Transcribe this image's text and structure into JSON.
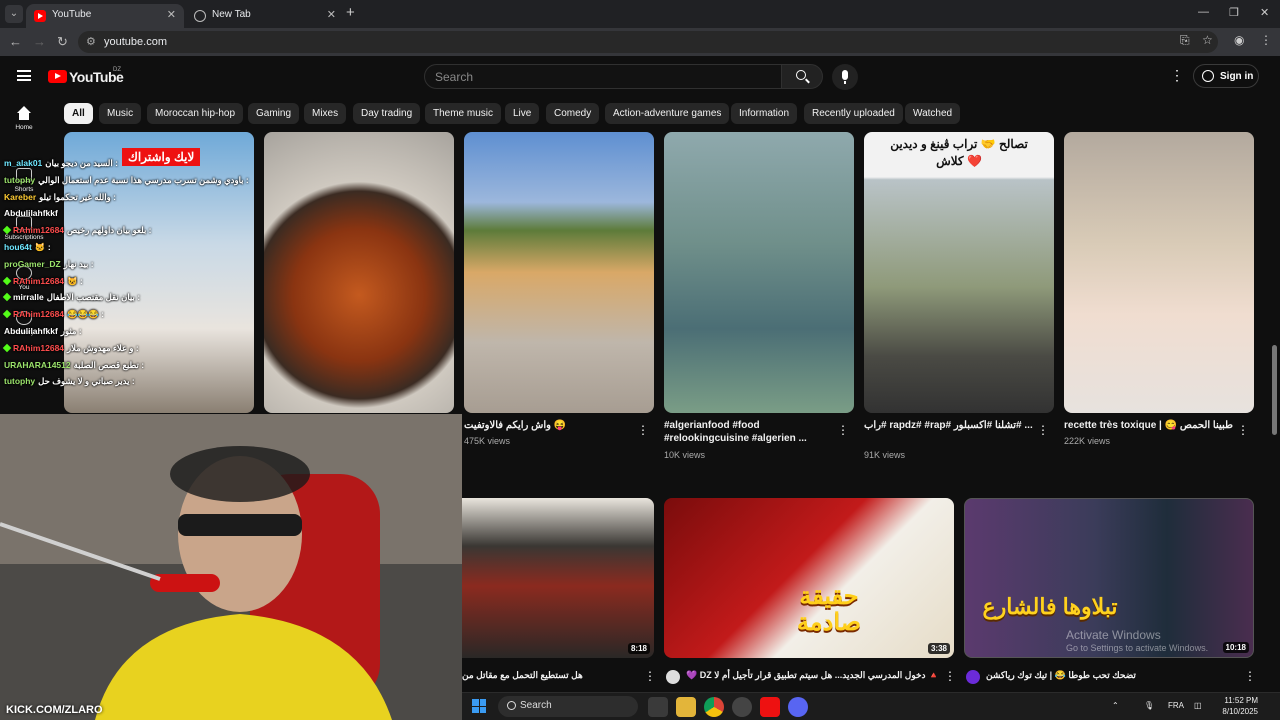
{
  "browser": {
    "tabs": [
      {
        "title": "YouTube",
        "close": "✕"
      },
      {
        "title": "New Tab",
        "close": "✕"
      }
    ],
    "new_tab": "+",
    "url": "youtube.com",
    "window": {
      "minimize": "—",
      "maximize": "❐",
      "close": "✕"
    }
  },
  "youtube": {
    "logo_text": "YouTube",
    "country": "DZ",
    "search_placeholder": "Search",
    "signin_label": "Sign in",
    "sidebar": [
      {
        "label": "Home",
        "icon": "home-icon"
      },
      {
        "label": "Shorts",
        "icon": "shorts-icon"
      },
      {
        "label": "Subscriptions",
        "icon": "subscriptions-icon"
      },
      {
        "label": "You",
        "icon": "you-icon"
      },
      {
        "label": "History",
        "icon": "history-icon"
      }
    ],
    "chips": [
      "All",
      "Music",
      "Moroccan hip-hop",
      "Gaming",
      "Mixes",
      "Day trading",
      "Theme music",
      "Live",
      "Comedy",
      "Action-adventure games",
      "Information",
      "Recently uploaded",
      "Watched"
    ],
    "shorts": [
      {
        "title": "",
        "views": "",
        "overlay": "لايك واشتراك"
      },
      {
        "title": "",
        "views": ""
      },
      {
        "title": "واش رايكم فالاوتفيت 😝",
        "views": "475K views"
      },
      {
        "title": "#algerianfood #food #relookingcuisine #algerien ...",
        "views": "10K views"
      },
      {
        "title": "راب# rapdz# #rap# تشلنا #اكسبلور# ...",
        "views": "91K views",
        "overlay": "تصالح 🤝 تراب ڤينغ و ديدين كلاش ❤️"
      },
      {
        "title": "recette très toxique | 😋 طبينا الحمص",
        "views": "222K views"
      }
    ],
    "videos": [
      {
        "title": "هل تستطيع التحمل مع مقاتل من",
        "duration": "8:18",
        "overlay": ""
      },
      {
        "title": "💜 DZ دخول المدرسي الجديد... هل سيتم تطبيق قرار تأجيل أم لا 🔺",
        "duration": "3:38",
        "overlay": "حقيقة صادمة"
      },
      {
        "title": "تضحك تحب طوطا 😂 | تيك توك رياكشن",
        "duration": "10:18",
        "overlay": "تبلاوها فالشارع"
      }
    ]
  },
  "stream": {
    "chat": [
      {
        "user": "m_alak01",
        "msg": "السيد من ديجو بيان :",
        "color": "#6ee7ff"
      },
      {
        "user": "tutophy",
        "msg": "باودي وشمن تسرب مدرسي هذا نسبة عدم استعمال الوالي :",
        "color": "#9be36b"
      },
      {
        "user": "Kareber",
        "msg": "والله غير تحكموا تيلو :",
        "color": "#ffcc33"
      },
      {
        "user": "Abdulilahfkkf",
        "msg": "",
        "color": "#ffffff"
      },
      {
        "user": "RAhim12684",
        "msg": "بلعو بيان داولهم رخيص :",
        "color": "#ff4d4d",
        "badge": true
      },
      {
        "user": "hou64t",
        "msg": "🐱 :",
        "color": "#6ee7ff"
      },
      {
        "user": "proGamer_DZ",
        "msg": "بيد نهار :",
        "color": "#9be36b"
      },
      {
        "user": "RAhim12684",
        "msg": "😺 :",
        "color": "#ff4d4d",
        "badge": true
      },
      {
        "user": "mirralle",
        "msg": "بيان نقل مقتصب الاطفال :",
        "color": "#ffffff",
        "badge": true
      },
      {
        "user": "RAhim12684",
        "msg": "😂😂😂 :",
        "color": "#ff4d4d",
        "badge": true
      },
      {
        "user": "Abdulilahfkkf",
        "msg": "مثور :",
        "color": "#ffffff"
      },
      {
        "user": "RAhim12684",
        "msg": "و علاء مهدوش ملار :",
        "color": "#ff4d4d",
        "badge": true
      },
      {
        "user": "URAHARA14512",
        "msg": "تطبع قصص الصلبة :",
        "color": "#9be36b"
      },
      {
        "user": "tutophy",
        "msg": "يدير صباتي و لا يشوف حل :",
        "color": "#9be36b"
      }
    ],
    "cam_handle": "KICK.COM/ZLARO"
  },
  "watermark": {
    "line1": "Activate Windows",
    "line2": "Go to Settings to activate Windows."
  },
  "taskbar": {
    "search_label": "Search",
    "language": "FRA",
    "time": "11:52 PM",
    "date": "8/10/2025"
  }
}
